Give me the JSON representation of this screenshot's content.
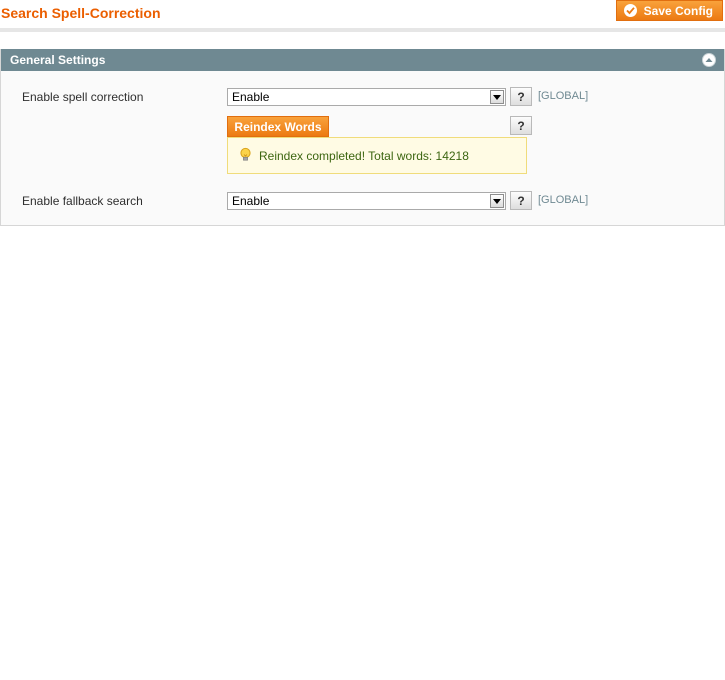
{
  "header": {
    "title": "Search Spell-Correction",
    "save_label": "Save Config"
  },
  "section": {
    "title": "General Settings",
    "rows": [
      {
        "label": "Enable spell correction",
        "value": "Enable",
        "scope": "[GLOBAL]"
      },
      {
        "label": "Enable fallback search",
        "value": "Enable",
        "scope": "[GLOBAL]"
      }
    ],
    "help_label": "?",
    "reindex_label": "Reindex Words",
    "notice_text": "Reindex completed! Total words: 14218"
  },
  "icons": {
    "save": "check-circle-icon",
    "collapse": "chevron-up-icon",
    "notice": "lightbulb-icon",
    "select": "dropdown-arrow-icon"
  },
  "colors": {
    "accent": "#eb5e00",
    "button": "#ec7a13",
    "section_header": "#6f8992",
    "notice_bg": "#fffbe4",
    "notice_text": "#3d6611"
  }
}
